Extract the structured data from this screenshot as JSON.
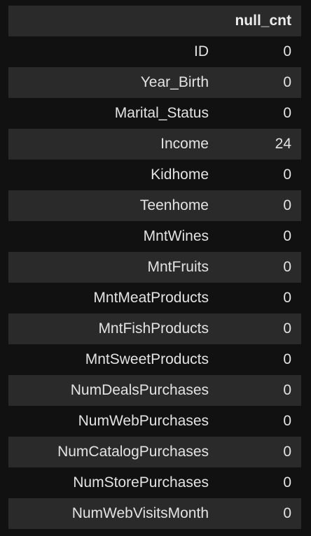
{
  "table": {
    "column_header": "null_cnt",
    "rows": [
      {
        "label": "ID",
        "value": "0"
      },
      {
        "label": "Year_Birth",
        "value": "0"
      },
      {
        "label": "Marital_Status",
        "value": "0"
      },
      {
        "label": "Income",
        "value": "24"
      },
      {
        "label": "Kidhome",
        "value": "0"
      },
      {
        "label": "Teenhome",
        "value": "0"
      },
      {
        "label": "MntWines",
        "value": "0"
      },
      {
        "label": "MntFruits",
        "value": "0"
      },
      {
        "label": "MntMeatProducts",
        "value": "0"
      },
      {
        "label": "MntFishProducts",
        "value": "0"
      },
      {
        "label": "MntSweetProducts",
        "value": "0"
      },
      {
        "label": "NumDealsPurchases",
        "value": "0"
      },
      {
        "label": "NumWebPurchases",
        "value": "0"
      },
      {
        "label": "NumCatalogPurchases",
        "value": "0"
      },
      {
        "label": "NumStorePurchases",
        "value": "0"
      },
      {
        "label": "NumWebVisitsMonth",
        "value": "0"
      }
    ]
  },
  "colors": {
    "background": "#111111",
    "stripe": "#2a2a2a",
    "text": "#e3e3e3"
  }
}
